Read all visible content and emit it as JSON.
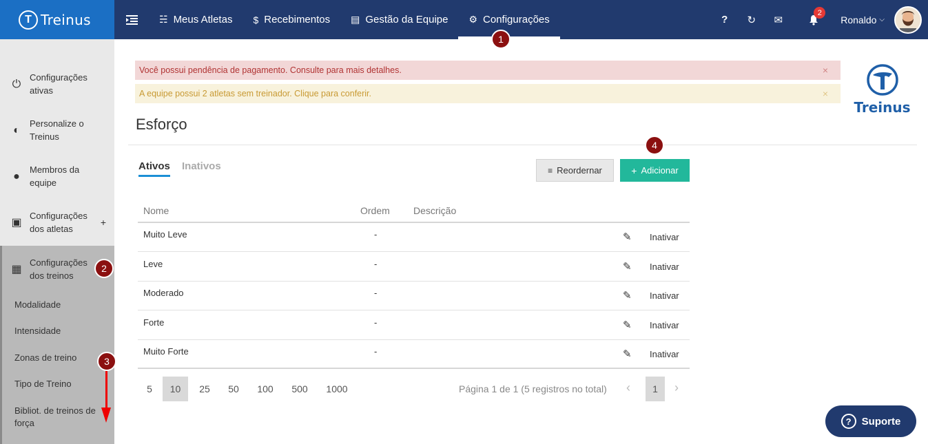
{
  "brand": {
    "name": "Treinus",
    "logo_glyph": "T"
  },
  "nav": {
    "menu_icon": "collapse-menu-icon",
    "items": [
      {
        "icon": "☵",
        "label": "Meus Atletas"
      },
      {
        "icon": "$",
        "label": "Recebimentos"
      },
      {
        "icon": "▤",
        "label": "Gestão da Equipe"
      },
      {
        "icon": "⚙",
        "label": "Configurações"
      }
    ]
  },
  "tools": {
    "help": "?",
    "sync": "↻",
    "mail": "✉",
    "bell": "⍾",
    "notifications": "2",
    "user_name": "Ronaldo",
    "caret": "⌄"
  },
  "sidebar": {
    "items": [
      {
        "icon": "⏻",
        "label": "Configurações ativas"
      },
      {
        "icon": "◐",
        "label": "Personalize o Treinus"
      },
      {
        "icon": "●",
        "label": "Membros da equipe"
      },
      {
        "icon": "▣",
        "label": "Configurações dos atletas",
        "plus": "+"
      },
      {
        "icon": "▦",
        "label": "Configurações dos treinos"
      }
    ],
    "subitems": [
      "Modalidade",
      "Intensidade",
      "Zonas de treino",
      "Tipo de Treino",
      "Bibliot. de treinos de força"
    ]
  },
  "steps": [
    "1",
    "2",
    "3",
    "4"
  ],
  "alerts": {
    "danger": "Você possui pendência de pagamento. Consulte para mais detalhes.",
    "warning": "A equipe possui 2 atletas sem treinador. Clique para conferir.",
    "close": "×"
  },
  "right_logo": "Treinus",
  "page_title": "Esforço",
  "tabs": {
    "active": "Ativos",
    "inactive": "Inativos"
  },
  "buttons": {
    "reorder": "Reordernar",
    "reorder_icon": "≡",
    "add": "Adicionar",
    "add_icon": "+"
  },
  "table": {
    "headers": {
      "name": "Nome",
      "order": "Ordem",
      "description": "Descrição"
    },
    "edit_icon": "✎",
    "action": "Inativar",
    "rows": [
      {
        "name": "Muito Leve",
        "order": "-"
      },
      {
        "name": "Leve",
        "order": "-"
      },
      {
        "name": "Moderado",
        "order": "-"
      },
      {
        "name": "Forte",
        "order": "-"
      },
      {
        "name": "Muito Forte",
        "order": "-"
      }
    ]
  },
  "pager": {
    "sizes": [
      "5",
      "10",
      "25",
      "50",
      "100",
      "500",
      "1000"
    ],
    "selected_size": "10",
    "info": "Página 1 de 1 (5 registros no total)",
    "prev": "‹",
    "next": "›",
    "current_page": "1"
  },
  "support": {
    "icon": "?",
    "label": "Suporte"
  },
  "colors": {
    "topbar": "#213a6e",
    "brand": "#1b6fc4",
    "add_button": "#22b89b",
    "step_marker": "#8b1010",
    "annotation_arrow": "#ee0000"
  }
}
